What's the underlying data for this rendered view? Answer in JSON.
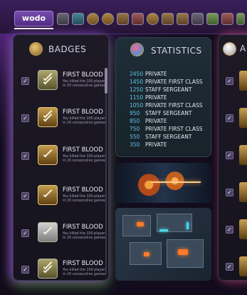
{
  "header": {
    "logo_text": "wodo",
    "nav_icons": [
      "id-card-icon",
      "gear-icon",
      "coin-icon",
      "coin-icon",
      "shield-icon",
      "drum-icon",
      "medal-icon",
      "trophy-icon",
      "chest-icon",
      "gamepad-icon",
      "controller-icon",
      "tile-icon",
      "card-icon",
      "phone-icon"
    ]
  },
  "badges": {
    "title": "BADGES",
    "items": [
      {
        "name": "FIRST BLOOD",
        "desc": "You killed the 100 players in 20 consecutive games",
        "checked": true,
        "style": "olive"
      },
      {
        "name": "FIRST BLOOD",
        "desc": "You killed the 100 players in 20 consecutive games",
        "checked": true,
        "style": "gold"
      },
      {
        "name": "FIRST BLOOD",
        "desc": "You killed the 100 players in 20 consecutive games",
        "checked": true,
        "style": "gold"
      },
      {
        "name": "FIRST BLOOD",
        "desc": "You killed the 100 players in 20 consecutive games",
        "checked": true,
        "style": "gold"
      },
      {
        "name": "FIRST BLOOD",
        "desc": "You killed the 100 players in 20 consecutive games",
        "checked": true,
        "style": "silver"
      },
      {
        "name": "FIRST BLOOD",
        "desc": "You killed the 100 players in 20 consecutive games",
        "checked": true,
        "style": "olive"
      }
    ]
  },
  "statistics": {
    "title": "STATISTICS",
    "rows": [
      {
        "value": "2450",
        "rank": "PRIVATE"
      },
      {
        "value": "1450",
        "rank": "PRIVATE FIRST CLASS"
      },
      {
        "value": "1250",
        "rank": "STAFF SERGEANT"
      },
      {
        "value": "1150",
        "rank": "PRIVATE"
      },
      {
        "value": "1050",
        "rank": "PRIVATE FIRST CLASS"
      },
      {
        "value": "950",
        "rank": "STAFF SERGEANT"
      },
      {
        "value": "850",
        "rank": "PRIVATE"
      },
      {
        "value": "750",
        "rank": "PRIVATE FIRST CLASS"
      },
      {
        "value": "550",
        "rank": "STAFF SERGEANT"
      },
      {
        "value": "350",
        "rank": "PRIVATE"
      }
    ]
  },
  "right_panel": {
    "title_partial": "A"
  },
  "colors": {
    "accent_purple": "#6a2fa0",
    "stat_number": "#5fc3e6",
    "gold": "#c9a052"
  }
}
